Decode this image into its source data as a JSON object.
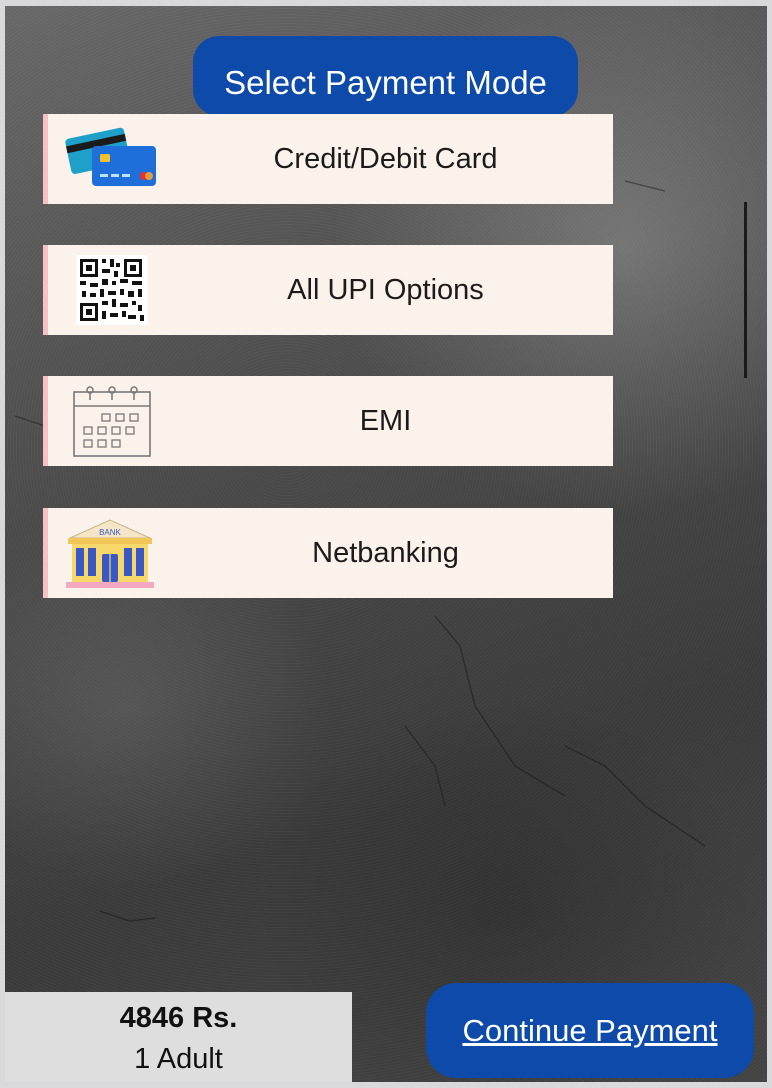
{
  "header": {
    "title": "Select Payment Mode"
  },
  "payment_options": [
    {
      "label": "Credit/Debit Card",
      "icon": "credit-card-icon"
    },
    {
      "label": "All UPI Options",
      "icon": "qr-code-icon"
    },
    {
      "label": "EMI",
      "icon": "calendar-icon"
    },
    {
      "label": "Netbanking",
      "icon": "bank-icon"
    }
  ],
  "bank_icon_text": "BANK",
  "summary": {
    "amount": "4846 Rs.",
    "passengers": "1 Adult"
  },
  "actions": {
    "continue_label": "Continue Payment"
  },
  "colors": {
    "primary_blue": "#0d4aa9",
    "option_background": "#fcf2ec",
    "option_accent": "#f6c2c5",
    "summary_background": "#dedede"
  }
}
